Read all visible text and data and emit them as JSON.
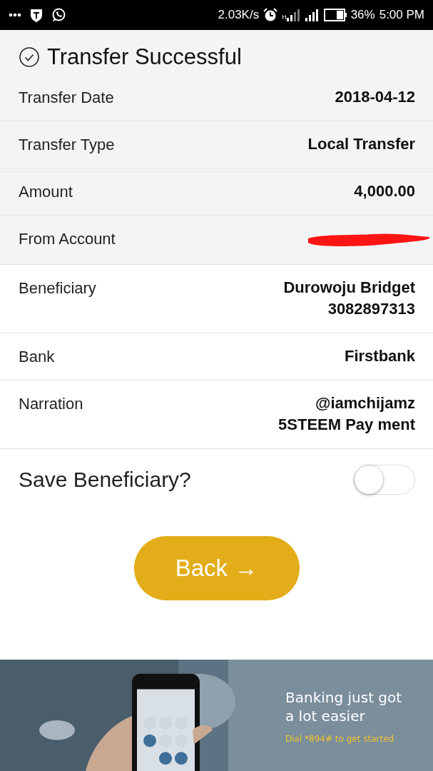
{
  "status_bar": {
    "speed": "2.03K/s",
    "network_type": "H",
    "battery": "36%",
    "time": "5:00 PM"
  },
  "dialog": {
    "title": "Transfer Successful",
    "rows": [
      {
        "label": "Transfer Date",
        "value": "2018-04-12",
        "shade": true
      },
      {
        "label": "Transfer Type",
        "value": "Local Transfer",
        "shade": true
      },
      {
        "label": "Amount",
        "value": "4,000.00",
        "shade": true
      },
      {
        "label": "From Account",
        "redacted": true,
        "shade": true
      },
      {
        "label": "Beneficiary",
        "value": "Durowoju Bridget 3082897313",
        "shade": false
      },
      {
        "label": "Bank",
        "value": "Firstbank",
        "shade": false
      },
      {
        "label": "Narration",
        "value": "@iamchijamz 5STEEM Pay ment",
        "shade": false
      }
    ],
    "save_beneficiary": {
      "label": "Save Beneficiary?",
      "on": false
    },
    "back_button": "Back →"
  },
  "banner": {
    "headline": "Banking just got a lot easier",
    "subline": "Dial *894# to get started"
  }
}
